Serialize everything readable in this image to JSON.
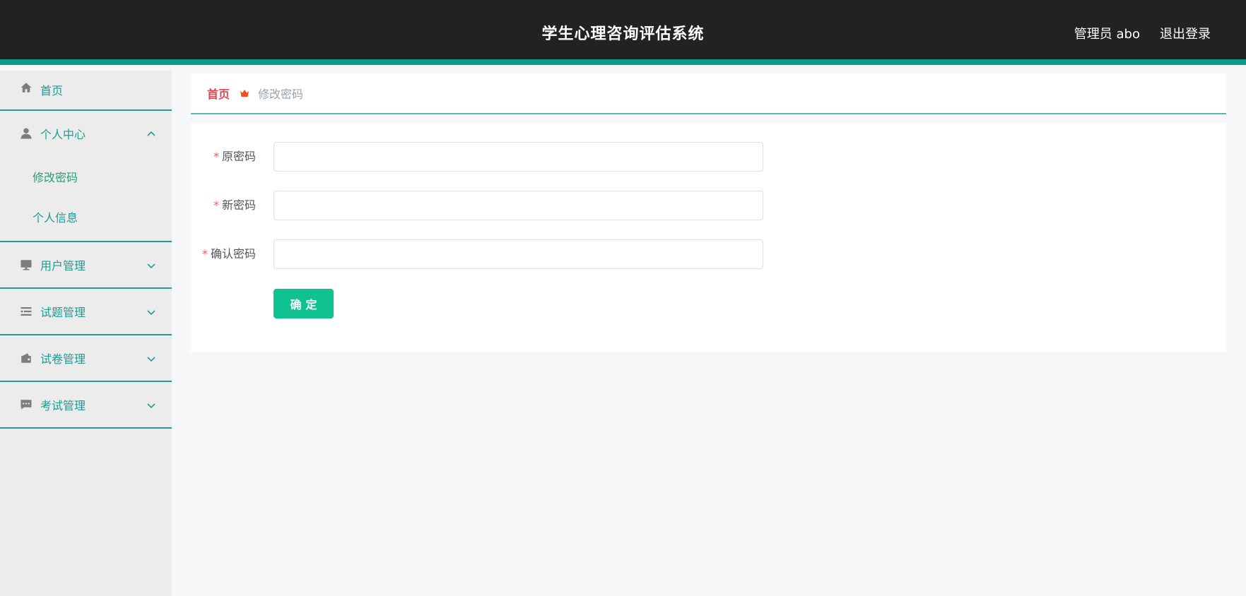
{
  "header": {
    "title": "学生心理咨询评估系统",
    "user_label": "管理员 abo",
    "logout_label": "退出登录"
  },
  "sidebar": {
    "items": [
      {
        "label": "首页",
        "icon": "home-icon"
      },
      {
        "label": "个人中心",
        "icon": "user-icon",
        "expanded": true,
        "children": [
          {
            "label": "修改密码",
            "active": true
          },
          {
            "label": "个人信息"
          }
        ]
      },
      {
        "label": "用户管理",
        "icon": "monitor-icon",
        "expanded": false
      },
      {
        "label": "试题管理",
        "icon": "list-icon",
        "expanded": false
      },
      {
        "label": "试卷管理",
        "icon": "wallet-icon",
        "expanded": false
      },
      {
        "label": "考试管理",
        "icon": "chat-icon",
        "expanded": false
      }
    ]
  },
  "breadcrumb": {
    "home": "首页",
    "current": "修改密码"
  },
  "form": {
    "required_mark": "*",
    "fields": [
      {
        "label": "原密码",
        "value": ""
      },
      {
        "label": "新密码",
        "value": ""
      },
      {
        "label": "确认密码",
        "value": ""
      }
    ],
    "submit_label": "确定"
  },
  "colors": {
    "accent": "#0e9b86",
    "menu_text": "#1e9c8f",
    "button": "#0fc28f",
    "breadcrumb_home": "#e1454d",
    "topbar": "#222222"
  }
}
